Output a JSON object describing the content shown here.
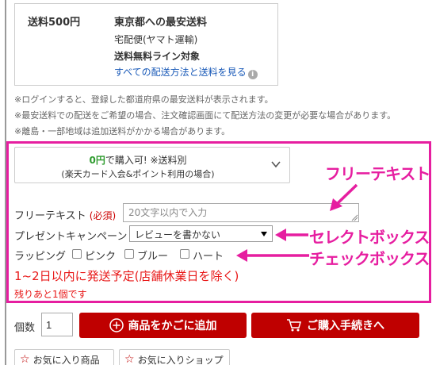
{
  "shipping": {
    "price": "送料500円",
    "title": "東京都への最安送料",
    "method": "宅配便(ヤマト運輸)",
    "free_line": "送料無料ライン対象",
    "link": "すべての配送方法と送料を見る"
  },
  "notes": [
    "※ログインすると、登録した都道府県の最安送料が表示されます。",
    "※最安送料での配送をご希望の場合、注文確認画面にて配送方法の変更が必要な場合があります。",
    "※離島・一部地域は追加送料がかかる場合があります。"
  ],
  "purchase_option": {
    "zero_yen": "0円",
    "line1_rest": "で購入可! ※送料別",
    "line2": "(楽天カード入会&ポイント利用の場合)"
  },
  "form": {
    "free_text_label": "フリーテキスト",
    "required": "(必須)",
    "free_text_placeholder": "20文字以内で入力",
    "campaign_label": "プレゼントキャンペーン",
    "campaign_selected": "レビューを書かない",
    "wrapping_label": "ラッピング",
    "wrapping_options": [
      "ピンク",
      "ブルー",
      "ハート"
    ]
  },
  "delivery": {
    "ship_date": "1~2日以内に発送予定(店舗休業日を除く)",
    "stock": "残りあと1個です"
  },
  "annotations": {
    "free_text": "フリーテキスト",
    "select_box": "セレクトボックス",
    "check_box": "チェックボックス"
  },
  "cart": {
    "qty_label": "個数",
    "qty_value": "1",
    "add_to_cart": "商品をかごに追加",
    "checkout": "ご購入手続きへ"
  },
  "favorites": {
    "item": "お気に入り商品",
    "shop": "お気に入りショップ"
  },
  "colors": {
    "accent_pink": "#e61ea0",
    "brand_red": "#bf0000",
    "alert_red": "#e81818",
    "link_blue": "#1a5ab8",
    "price_green": "#2e9b2e"
  }
}
